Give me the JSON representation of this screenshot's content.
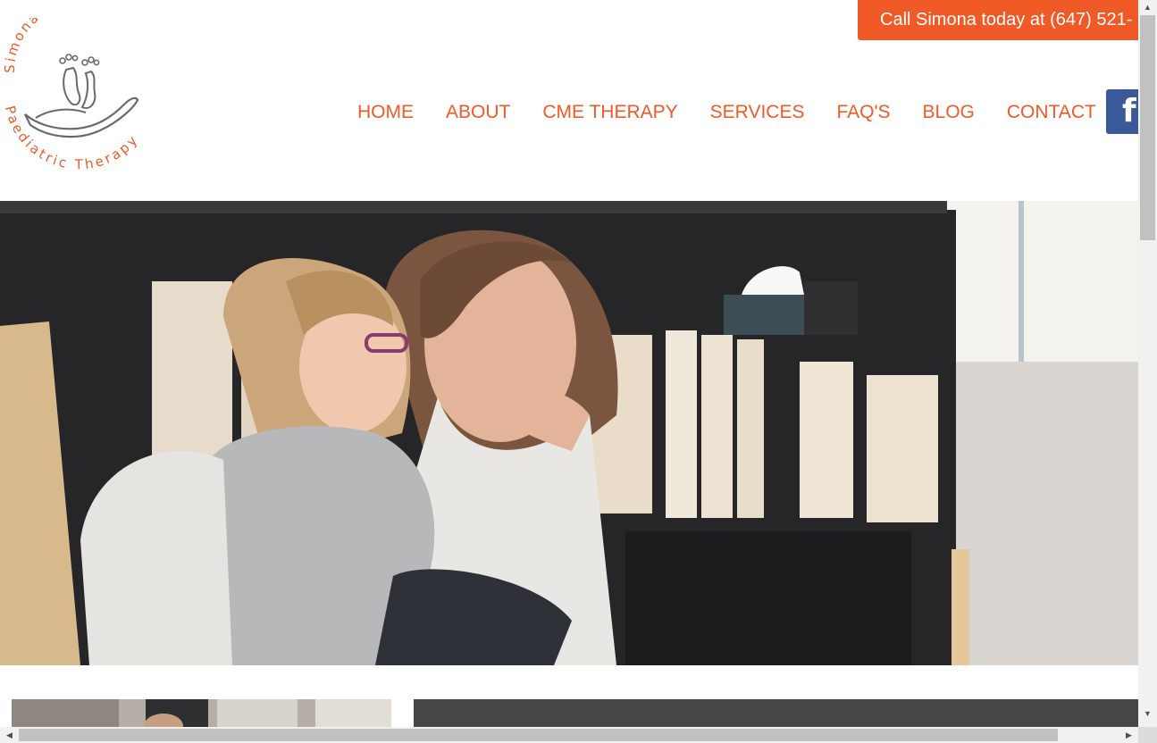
{
  "header": {
    "logo": {
      "top_text": "Simona DeMarchi",
      "bottom_text": "Paediatric Therapy",
      "brand_color": "#ef5a27"
    },
    "call_label": "Call Simona today at (647) 521-",
    "social": {
      "facebook_glyph": "f",
      "icon": "facebook-icon"
    }
  },
  "nav": {
    "items": [
      {
        "label": "HOME"
      },
      {
        "label": "ABOUT"
      },
      {
        "label": "CME THERAPY"
      },
      {
        "label": "SERVICES"
      },
      {
        "label": "FAQ'S"
      },
      {
        "label": "BLOG"
      },
      {
        "label": "CONTACT"
      }
    ]
  },
  "colors": {
    "accent": "#ef5a27",
    "facebook": "#3b5998",
    "dark_panel": "#464646"
  },
  "scrollbars": {
    "up_arrow": "▲",
    "down_arrow": "▼",
    "left_arrow": "◀",
    "right_arrow": "▶"
  }
}
